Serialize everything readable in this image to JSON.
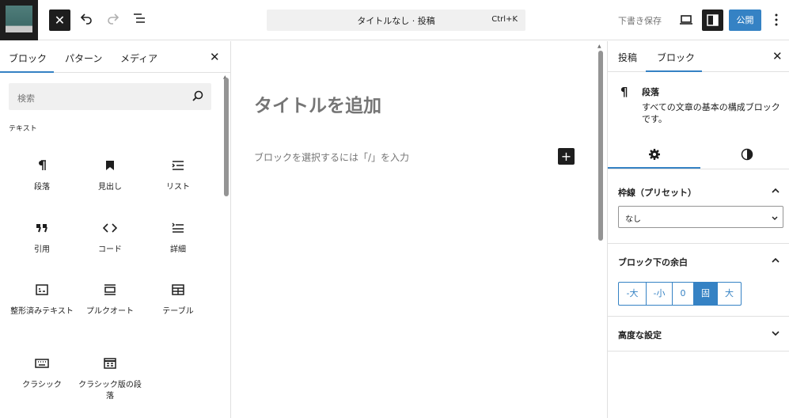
{
  "topbar": {
    "close_label": "✕",
    "command_title": "タイトルなし · 投稿",
    "command_shortcut": "Ctrl+K",
    "draft_label": "下書き保存",
    "publish_label": "公開"
  },
  "inserter_panel": {
    "tabs": [
      "ブロック",
      "パターン",
      "メディア"
    ],
    "close_label": "✕",
    "search_placeholder": "検索",
    "category": "テキスト",
    "blocks": [
      {
        "label": "段落",
        "icon": "paragraph-icon"
      },
      {
        "label": "見出し",
        "icon": "heading-bookmark-icon"
      },
      {
        "label": "リスト",
        "icon": "list-icon"
      },
      {
        "label": "引用",
        "icon": "quote-icon"
      },
      {
        "label": "コード",
        "icon": "code-icon"
      },
      {
        "label": "詳細",
        "icon": "details-icon"
      },
      {
        "label": "整形済みテキスト",
        "icon": "preformatted-icon"
      },
      {
        "label": "プルクオート",
        "icon": "pullquote-icon"
      },
      {
        "label": "テーブル",
        "icon": "table-icon"
      },
      {
        "label": "クラシック",
        "icon": "keyboard-icon"
      },
      {
        "label": "クラシック版の段落",
        "icon": "classic-paragraph-icon"
      }
    ]
  },
  "editor": {
    "title_placeholder": "タイトルを追加",
    "paragraph_placeholder": "ブロックを選択するには「/」を入力",
    "inserter_label": "+"
  },
  "settings_panel": {
    "tabs": [
      "投稿",
      "ブロック"
    ],
    "close_label": "✕",
    "block_icon": "¶",
    "block_title": "段落",
    "block_description": "すべての文章の基本の構成ブロックです。",
    "border_section_title": "枠線（プリセット）",
    "border_value": "なし",
    "margin_section_title": "ブロック下の余白",
    "margin_options": [
      "-大",
      "-小",
      "0",
      "固",
      "大"
    ],
    "margin_selected": "固",
    "advanced_title": "高度な設定"
  },
  "colors": {
    "accent": "#3582c4",
    "dark": "#1e1e1e",
    "muted": "#757575"
  }
}
